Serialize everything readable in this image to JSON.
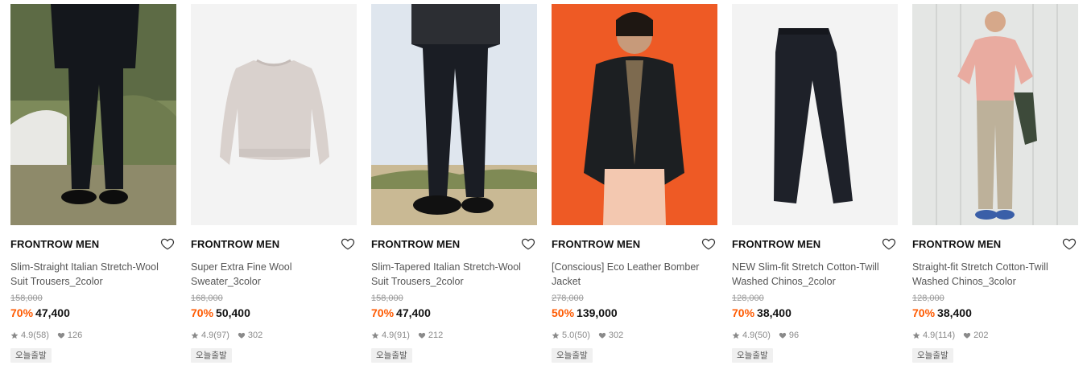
{
  "colors": {
    "discount": "#ff5a00",
    "badge_bg": "#f0f0f0"
  },
  "products": [
    {
      "brand": "FRONTROW MEN",
      "name": "Slim-Straight Italian Stretch-Wool Suit Trousers_2color",
      "original_price": "158,000",
      "discount": "70%",
      "price": "47,400",
      "rating": "4.9",
      "reviews": "(58)",
      "likes": "126",
      "badge": "오늘출발",
      "image": "black-suit-model-grass"
    },
    {
      "brand": "FRONTROW MEN",
      "name": "Super Extra Fine Wool Sweater_3color",
      "original_price": "168,000",
      "discount": "70%",
      "price": "50,400",
      "rating": "4.9",
      "reviews": "(97)",
      "likes": "302",
      "badge": "오늘출발",
      "image": "beige-sweater-flatlay"
    },
    {
      "brand": "FRONTROW MEN",
      "name": "Slim-Tapered Italian Stretch-Wool Suit Trousers_2color",
      "original_price": "158,000",
      "discount": "70%",
      "price": "47,400",
      "rating": "4.9",
      "reviews": "(91)",
      "likes": "212",
      "badge": "오늘출발",
      "image": "trousers-model-sand"
    },
    {
      "brand": "FRONTROW MEN",
      "name": "[Conscious] Eco Leather Bomber Jacket",
      "original_price": "278,000",
      "discount": "50%",
      "price": "139,000",
      "rating": "5.0",
      "reviews": "(50)",
      "likes": "302",
      "badge": "오늘출발",
      "image": "leather-jacket-orange-bg"
    },
    {
      "brand": "FRONTROW MEN",
      "name": "NEW Slim-fit Stretch Cotton-Twill Washed Chinos_2color",
      "original_price": "128,000",
      "discount": "70%",
      "price": "38,400",
      "rating": "4.9",
      "reviews": "(50)",
      "likes": "96",
      "badge": "오늘출발",
      "image": "navy-chinos-flatlay"
    },
    {
      "brand": "FRONTROW MEN",
      "name": "Straight-fit Stretch Cotton-Twill Washed Chinos_3color",
      "original_price": "128,000",
      "discount": "70%",
      "price": "38,400",
      "rating": "4.9",
      "reviews": "(114)",
      "likes": "202",
      "badge": "오늘출발",
      "image": "pink-tee-chinos-model"
    }
  ]
}
